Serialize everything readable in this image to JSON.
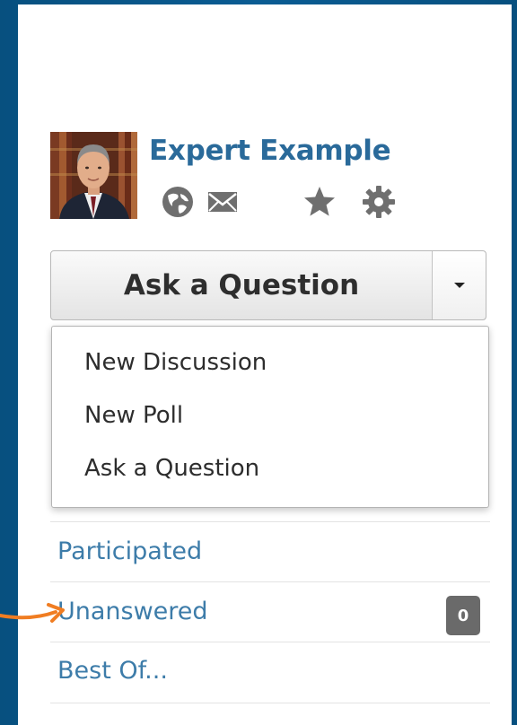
{
  "profile": {
    "name": "Expert Example",
    "icons": [
      "globe-icon",
      "mail-icon",
      "star-icon",
      "gear-icon"
    ]
  },
  "ask_button": {
    "label": "Ask a Question",
    "caret_icon": "caret-down-icon"
  },
  "menu": {
    "items": [
      {
        "label": "New Discussion"
      },
      {
        "label": "New Poll"
      },
      {
        "label": "Ask a Question"
      }
    ]
  },
  "nav": {
    "items": [
      {
        "label": "Participated"
      },
      {
        "label": "Unanswered",
        "count": "0"
      },
      {
        "label": "Best Of..."
      }
    ]
  },
  "colors": {
    "link": "#3d7ca9",
    "name": "#2a6a9a",
    "frame": "#0a5a92",
    "arrow": "#f07d22",
    "badge": "#6a6a6a"
  }
}
